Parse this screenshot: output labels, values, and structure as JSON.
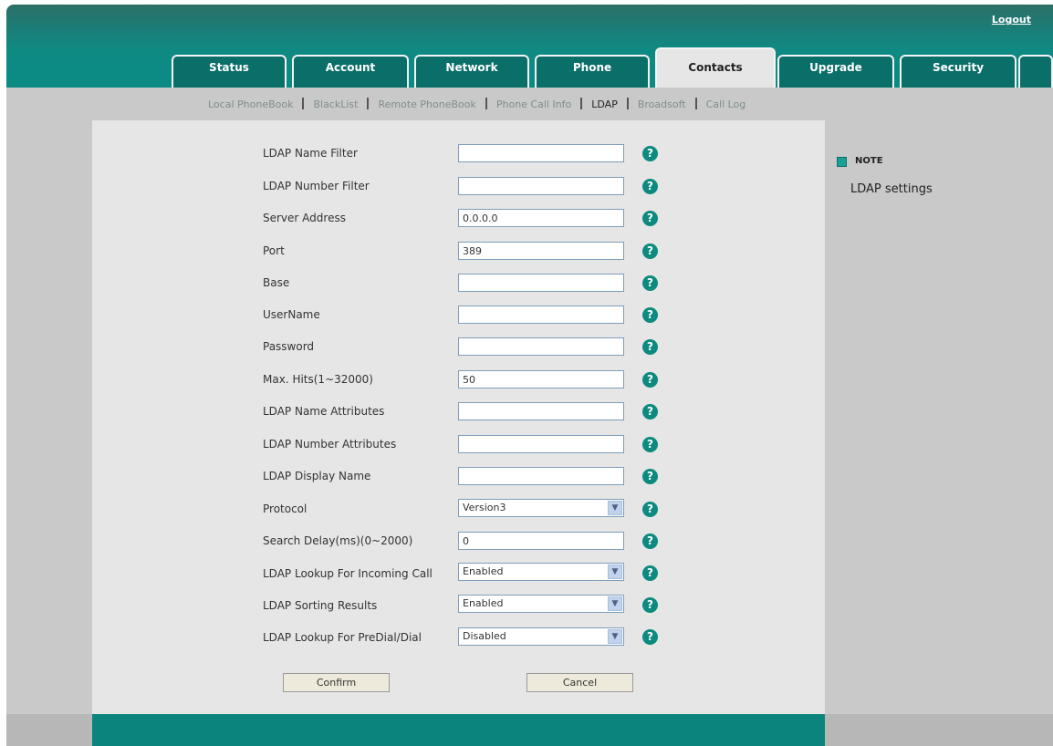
{
  "header": {
    "logout_label": "Logout"
  },
  "tabs": [
    "Status",
    "Account",
    "Network",
    "Phone",
    "Contacts",
    "Upgrade",
    "Security"
  ],
  "active_tab": "Contacts",
  "submenu": [
    "Local PhoneBook",
    "BlackList",
    "Remote PhoneBook",
    "Phone Call Info",
    "LDAP",
    "Broadsoft",
    "Call Log"
  ],
  "active_submenu": "LDAP",
  "form": {
    "ldap_name_filter": {
      "label": "LDAP Name Filter",
      "value": ""
    },
    "ldap_number_filter": {
      "label": "LDAP Number Filter",
      "value": ""
    },
    "server_address": {
      "label": "Server Address",
      "value": "0.0.0.0"
    },
    "port": {
      "label": "Port",
      "value": "389"
    },
    "base": {
      "label": "Base",
      "value": ""
    },
    "username": {
      "label": "UserName",
      "value": ""
    },
    "password": {
      "label": "Password",
      "value": ""
    },
    "max_hits": {
      "label": "Max. Hits(1~32000)",
      "value": "50"
    },
    "ldap_name_attributes": {
      "label": "LDAP Name Attributes",
      "value": ""
    },
    "ldap_number_attributes": {
      "label": "LDAP Number Attributes",
      "value": ""
    },
    "ldap_display_name": {
      "label": "LDAP Display Name",
      "value": ""
    },
    "protocol": {
      "label": "Protocol",
      "value": "Version3"
    },
    "search_delay": {
      "label": "Search Delay(ms)(0~2000)",
      "value": "0"
    },
    "lookup_incoming_call": {
      "label": "LDAP Lookup For Incoming Call",
      "value": "Enabled"
    },
    "sorting_results": {
      "label": "LDAP Sorting Results",
      "value": "Enabled"
    },
    "lookup_predial": {
      "label": "LDAP Lookup For PreDial/Dial",
      "value": "Disabled"
    }
  },
  "help_glyph": "?",
  "buttons": {
    "confirm": "Confirm",
    "cancel": "Cancel"
  },
  "note": {
    "title": "NOTE",
    "text": "LDAP settings"
  },
  "colors": {
    "header": "#0b847e",
    "tab": "#0a6e69",
    "help": "#0d8a80",
    "panel": "#e6e6e6",
    "side": "#c9c9c9"
  },
  "icons": {
    "help": "help-icon",
    "note": "note-square-icon",
    "select_arrow": "chevron-down-icon"
  }
}
